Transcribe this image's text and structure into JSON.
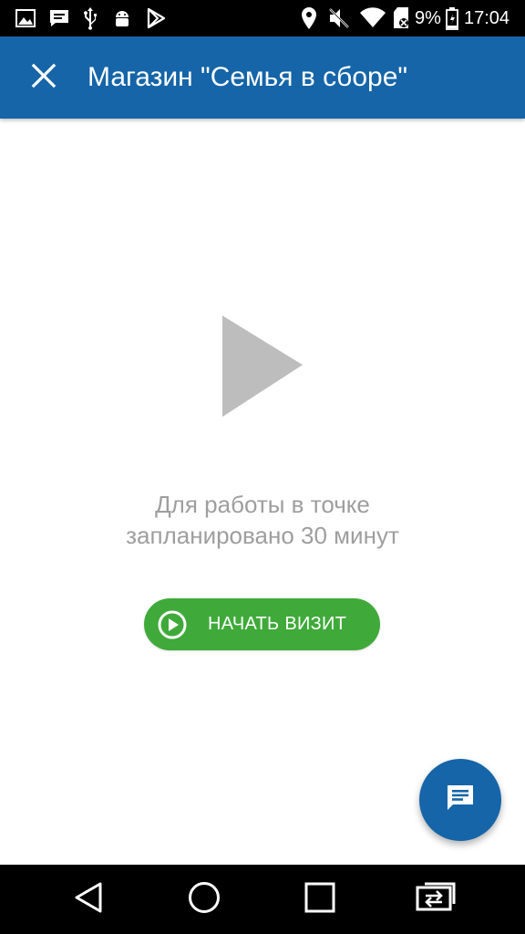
{
  "status_bar": {
    "battery_percent": "9%",
    "time": "17:04",
    "left_icons": [
      "image-icon",
      "message-icon",
      "usb-icon",
      "android-icon",
      "play-store-icon"
    ],
    "right_icons": [
      "location-icon",
      "mute-icon",
      "wifi-icon",
      "sd-card-icon",
      "battery-icon"
    ]
  },
  "app_bar": {
    "title": "Магазин \"Семья в сборе\"",
    "close_icon": "close-icon",
    "color": "#1565a8"
  },
  "main": {
    "play_icon": "play-icon",
    "info_line1": "Для работы в точке",
    "info_line2": "запланировано 30 минут",
    "start_button": {
      "label": "НАЧАТЬ ВИЗИТ",
      "icon": "play-circle-icon",
      "color": "#3faa3a"
    }
  },
  "fab": {
    "icon": "chat-icon",
    "color": "#1565a8"
  },
  "nav_bar": {
    "buttons": [
      "back-icon",
      "home-icon",
      "recents-icon",
      "switch-app-icon"
    ]
  }
}
